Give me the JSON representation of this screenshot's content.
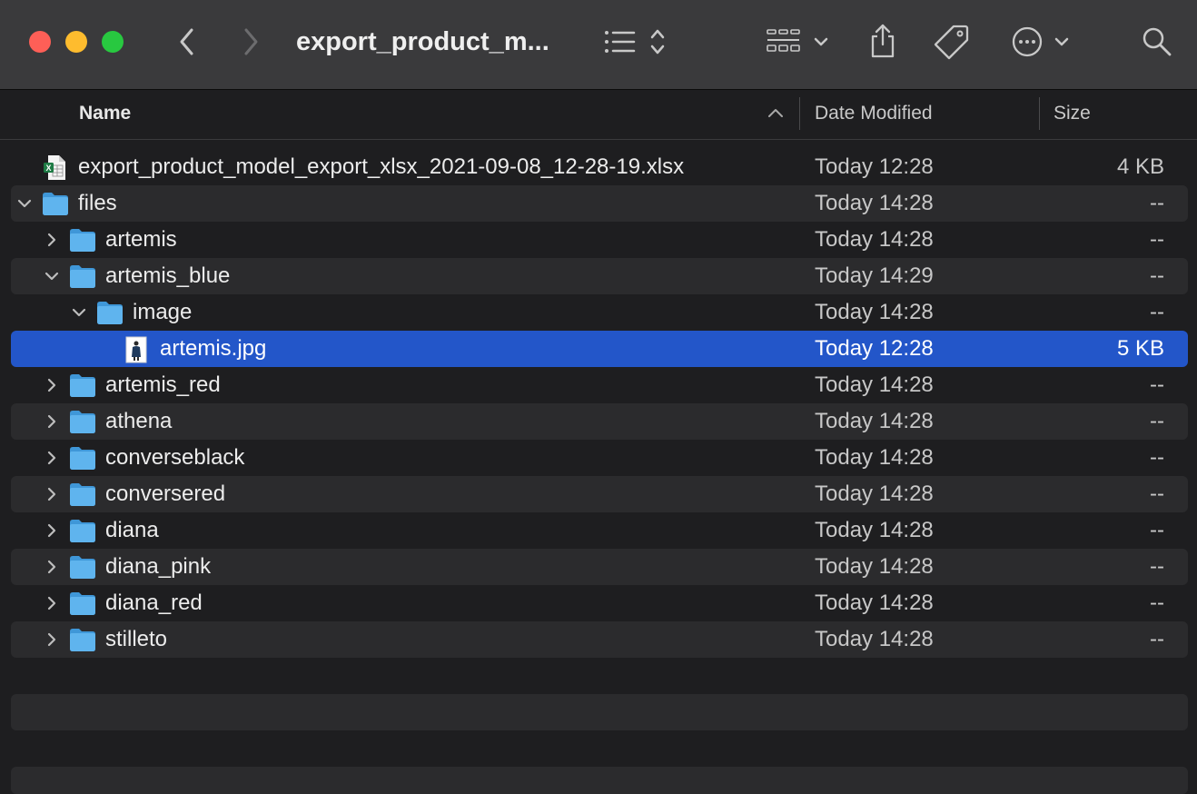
{
  "window": {
    "title": "export_product_m...",
    "toolbar": {
      "back_icon": "chevron-left-icon",
      "forward_icon": "chevron-right-icon",
      "view_icon": "list-view-icon",
      "group_icon": "grid-group-icon",
      "share_icon": "share-icon",
      "tag_icon": "tag-icon",
      "more_icon": "ellipsis-circle-icon",
      "search_icon": "search-icon"
    }
  },
  "columns": {
    "name": "Name",
    "date": "Date Modified",
    "size": "Size"
  },
  "rows": [
    {
      "name": "export_product_model_export_xlsx_2021-09-08_12-28-19.xlsx",
      "date": "Today 12:28",
      "size": "4 KB",
      "kind": "xlsx",
      "level": 0,
      "disclosure": "none"
    },
    {
      "name": "files",
      "date": "Today 14:28",
      "size": "--",
      "kind": "folder",
      "level": 0,
      "disclosure": "open"
    },
    {
      "name": "artemis",
      "date": "Today 14:28",
      "size": "--",
      "kind": "folder",
      "level": 1,
      "disclosure": "closed"
    },
    {
      "name": "artemis_blue",
      "date": "Today 14:29",
      "size": "--",
      "kind": "folder",
      "level": 1,
      "disclosure": "open"
    },
    {
      "name": "image",
      "date": "Today 14:28",
      "size": "--",
      "kind": "folder",
      "level": 2,
      "disclosure": "open"
    },
    {
      "name": "artemis.jpg",
      "date": "Today 12:28",
      "size": "5 KB",
      "kind": "jpg",
      "level": 3,
      "disclosure": "none",
      "selected": true
    },
    {
      "name": "artemis_red",
      "date": "Today 14:28",
      "size": "--",
      "kind": "folder",
      "level": 1,
      "disclosure": "closed"
    },
    {
      "name": "athena",
      "date": "Today 14:28",
      "size": "--",
      "kind": "folder",
      "level": 1,
      "disclosure": "closed"
    },
    {
      "name": "converseblack",
      "date": "Today 14:28",
      "size": "--",
      "kind": "folder",
      "level": 1,
      "disclosure": "closed"
    },
    {
      "name": "conversered",
      "date": "Today 14:28",
      "size": "--",
      "kind": "folder",
      "level": 1,
      "disclosure": "closed"
    },
    {
      "name": "diana",
      "date": "Today 14:28",
      "size": "--",
      "kind": "folder",
      "level": 1,
      "disclosure": "closed"
    },
    {
      "name": "diana_pink",
      "date": "Today 14:28",
      "size": "--",
      "kind": "folder",
      "level": 1,
      "disclosure": "closed"
    },
    {
      "name": "diana_red",
      "date": "Today 14:28",
      "size": "--",
      "kind": "folder",
      "level": 1,
      "disclosure": "closed"
    },
    {
      "name": "stilleto",
      "date": "Today 14:28",
      "size": "--",
      "kind": "folder",
      "level": 1,
      "disclosure": "closed"
    }
  ],
  "colors": {
    "selection": "#2356c9",
    "folder": "#5fb4ee",
    "window_bg": "#1e1e20",
    "toolbar_bg": "#3a3a3c"
  }
}
